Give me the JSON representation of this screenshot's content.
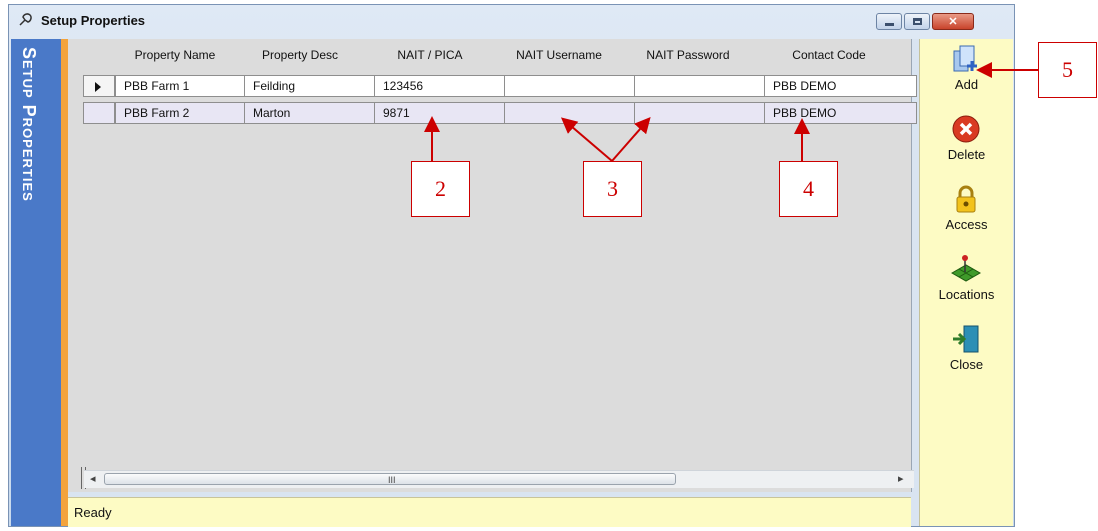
{
  "window": {
    "title": "Setup Properties"
  },
  "sidebar": {
    "label": "Setup Properties"
  },
  "grid": {
    "columns": [
      "Property Name",
      "Property Desc",
      "NAIT / PICA",
      "NAIT Username",
      "NAIT Password",
      "Contact Code"
    ],
    "rows": [
      {
        "name": "PBB Farm 1",
        "desc": "Feilding",
        "nait_pica": "123456",
        "nait_username": "",
        "nait_password": "",
        "contact_code": "PBB DEMO"
      },
      {
        "name": "PBB Farm 2",
        "desc": "Marton",
        "nait_pica": "9871",
        "nait_username": "",
        "nait_password": "",
        "contact_code": "PBB DEMO"
      }
    ],
    "scroll_grip": "III"
  },
  "status": {
    "text": "Ready"
  },
  "toolbar": {
    "add_label": "Add",
    "delete_label": "Delete",
    "access_label": "Access",
    "locations_label": "Locations",
    "close_label": "Close"
  },
  "annotations": {
    "a2": "2",
    "a3": "3",
    "a4": "4",
    "a5": "5"
  },
  "colors": {
    "sidebar": "#4a79c8",
    "accent_strip": "#f3a33c",
    "toolbar_bg": "#fdfbc4",
    "annotation": "#cc0000",
    "selected_row": "#e8e6f4"
  },
  "icons": [
    "pin-icon",
    "minimize-icon",
    "maximize-icon",
    "close-x-icon",
    "add-icon",
    "delete-icon",
    "access-icon",
    "locations-icon",
    "close-door-icon"
  ]
}
